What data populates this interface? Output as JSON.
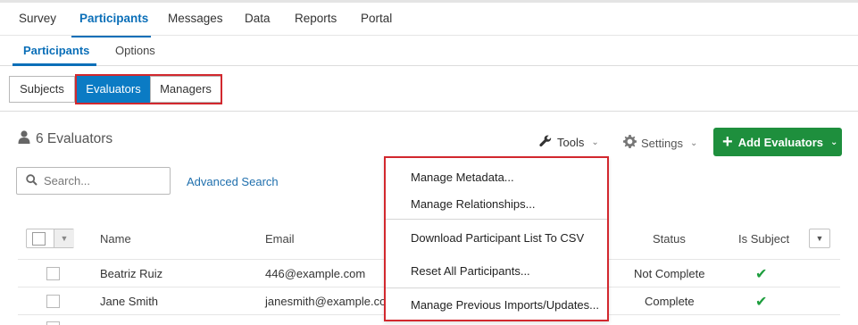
{
  "top_tabs": [
    "Survey",
    "Participants",
    "Messages",
    "Data",
    "Reports",
    "Portal"
  ],
  "active_top_tab": "Participants",
  "sub_tabs": [
    "Participants",
    "Options"
  ],
  "roles": [
    "Subjects",
    "Evaluators",
    "Managers"
  ],
  "active_role": "Evaluators",
  "header": {
    "count_label": "6 Evaluators",
    "tools_label": "Tools",
    "settings_label": "Settings",
    "add_button_label": "Add Evaluators"
  },
  "search": {
    "placeholder": "Search...",
    "advanced_link": "Advanced Search"
  },
  "table": {
    "columns": [
      "Name",
      "Email",
      "Status",
      "Is Subject"
    ],
    "rows": [
      {
        "name": "Beatriz Ruiz",
        "email": "446@example.com",
        "status": "Not Complete",
        "is_subject": true
      },
      {
        "name": "Jane Smith",
        "email": "janesmith@example.com",
        "status": "Complete",
        "is_subject": true
      }
    ]
  },
  "tools_menu": {
    "items": [
      "Manage Metadata...",
      "Manage Relationships...",
      "Download Participant List To CSV",
      "Reset All Participants...",
      "Manage Previous Imports/Updates..."
    ]
  },
  "colors": {
    "accent_blue": "#0b7bc4",
    "add_green": "#1e8f3d",
    "highlight_red": "#d2282e",
    "check_green": "#1e9e3e"
  }
}
